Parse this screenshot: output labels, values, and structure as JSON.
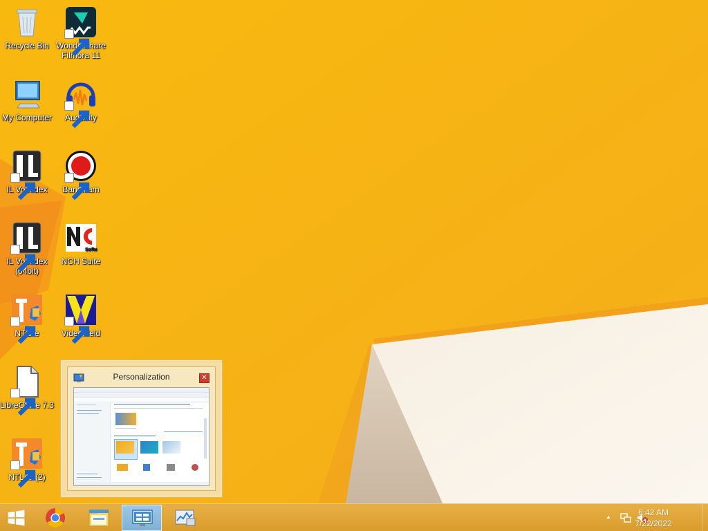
{
  "desktop": {
    "icons": [
      {
        "label": "Recycle Bin"
      },
      {
        "label": "Wondershare Filmora 11"
      },
      {
        "label": "My Computer"
      },
      {
        "label": "Audacity"
      },
      {
        "label": "IL Vocodex"
      },
      {
        "label": "Bandicam"
      },
      {
        "label": "IL Vocodex (64bit)"
      },
      {
        "label": "NCH Suite"
      },
      {
        "label": "NTLite"
      },
      {
        "label": "VideoMeld"
      },
      {
        "label": "LibreOffice 7.3"
      },
      {
        "label": "NTLite (2)"
      }
    ]
  },
  "preview": {
    "title": "Personalization",
    "close_glyph": "✕",
    "icon": "personalization-icon"
  },
  "taskbar": {
    "items": [
      {
        "icon": "windows-start-icon"
      },
      {
        "icon": "chrome-icon"
      },
      {
        "icon": "file-explorer-icon"
      },
      {
        "icon": "control-panel-icon"
      },
      {
        "icon": "resource-monitor-icon"
      }
    ],
    "tray": {
      "chevron_glyph": "▲",
      "time": "6:42 AM",
      "date": "7/22/2022"
    }
  },
  "colors": {
    "wallpaper": "#f7b411",
    "taskbar": "#e0a638",
    "active_task": "#8fbde0"
  }
}
